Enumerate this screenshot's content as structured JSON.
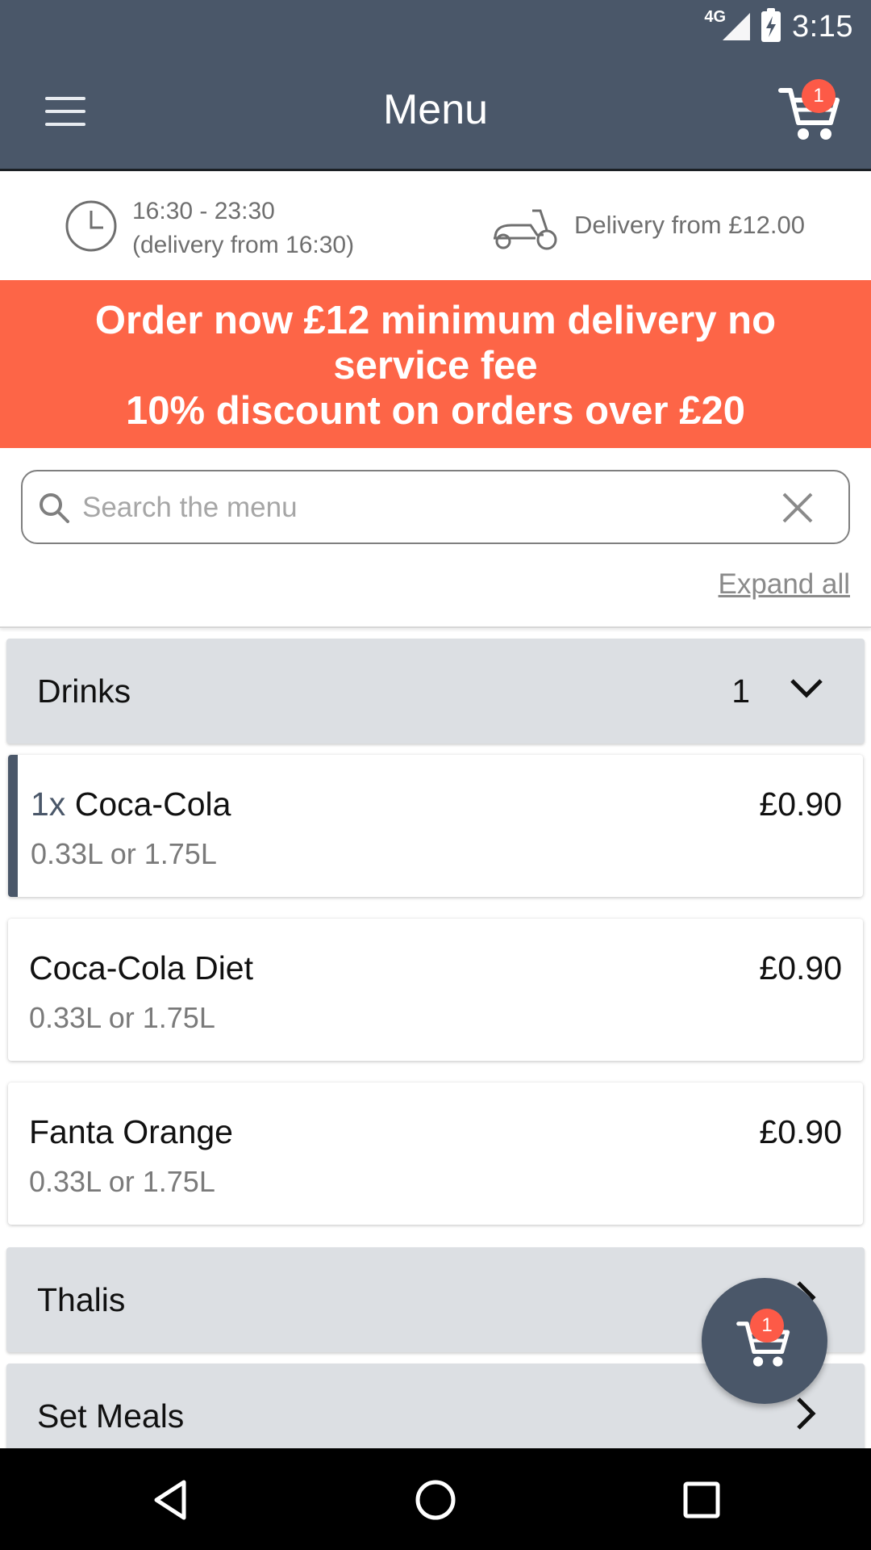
{
  "status_bar": {
    "network": "4G",
    "time": "3:15"
  },
  "app_bar": {
    "title": "Menu",
    "cart_count": "1"
  },
  "info": {
    "hours": "16:30 - 23:30",
    "delivery_hours": "(delivery from 16:30)",
    "delivery_minimum": "Delivery from £12.00"
  },
  "promo": {
    "line1": "Order now £12 minimum delivery no service fee",
    "line2": "10% discount on orders over £20"
  },
  "search": {
    "placeholder": "Search the menu",
    "value": ""
  },
  "expand_all": "Expand all",
  "sections": [
    {
      "title": "Drinks",
      "count": "1",
      "items": [
        {
          "qty": "1x",
          "name": "Coca-Cola",
          "desc": "0.33L or 1.75L",
          "price": "£0.90"
        },
        {
          "name": "Coca-Cola Diet",
          "desc": "0.33L or 1.75L",
          "price": "£0.90"
        },
        {
          "name": "Fanta Orange",
          "desc": "0.33L or 1.75L",
          "price": "£0.90"
        }
      ]
    },
    {
      "title": "Thalis"
    },
    {
      "title": "Set Meals"
    }
  ],
  "fab": {
    "cart_count": "1"
  },
  "colors": {
    "primary": "#4a5769",
    "accent": "#fd6547",
    "badge": "#fd5a47",
    "section_bg": "#dcdfe3"
  }
}
